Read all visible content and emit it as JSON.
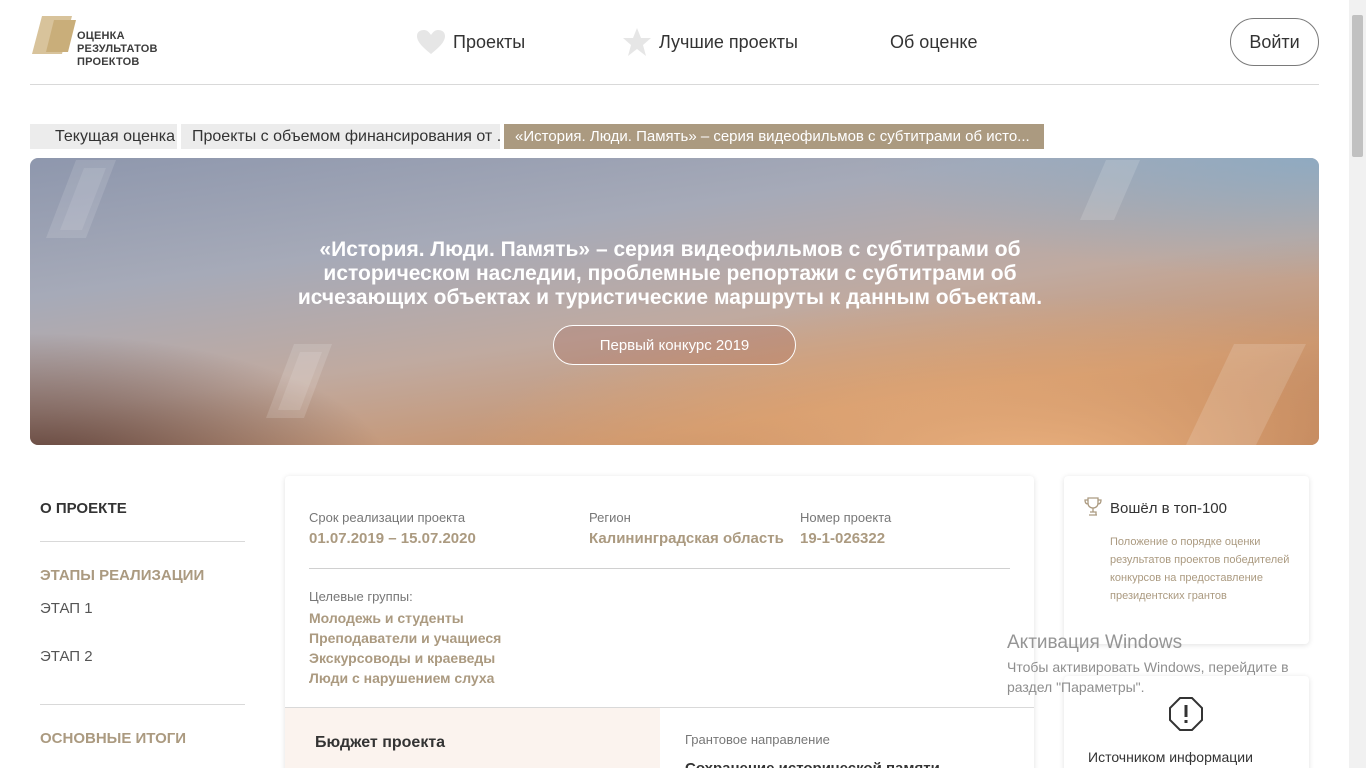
{
  "header": {
    "logo_lines": [
      "ОЦЕНКА",
      "РЕЗУЛЬТАТОВ",
      "ПРОЕКТОВ"
    ],
    "nav": {
      "projects": "Проекты",
      "best": "Лучшие проекты",
      "about": "Об оценке"
    },
    "login": "Войти"
  },
  "breadcrumbs": [
    "Текущая оценка",
    "Проекты с объемом финансирования от ...",
    "«История. Люди. Память» – серия видеофильмов с субтитрами об исто..."
  ],
  "hero": {
    "title": "«История. Люди. Память» – серия видеофильмов с субтитрами об историческом наследии, проблемные репортажи с субтитрами об исчезающих объектах и туристические маршруты к данным объектам.",
    "contest": "Первый конкурс 2019"
  },
  "sidebar": {
    "about": "О ПРОЕКТЕ",
    "stages": "ЭТАПЫ РЕАЛИЗАЦИИ",
    "stage1": "ЭТАП 1",
    "stage2": "ЭТАП 2",
    "results": "ОСНОВНЫЕ ИТОГИ"
  },
  "project": {
    "term_label": "Срок реализации проекта",
    "term": "01.07.2019 – 15.07.2020",
    "region_label": "Регион",
    "region": "Калининградская область",
    "number_label": "Номер проекта",
    "number": "19-1-026322",
    "groups_label": "Целевые группы:",
    "groups": [
      "Молодежь и студенты",
      "Преподаватели и учащиеся",
      "Экскурсоводы и краеведы",
      "Люди с нарушением слуха"
    ],
    "budget_title": "Бюджет проекта",
    "grant_label": "Грантовое направление",
    "grant_value": "Сохранение исторической памяти"
  },
  "top100": {
    "title": "Вошёл в топ-100",
    "text": "Положение о порядке оценки результатов проектов победителей конкурсов на предоставление президентских грантов"
  },
  "source": {
    "text": "Источником информации"
  },
  "watermark": {
    "title": "Активация Windows",
    "text": "Чтобы активировать Windows, перейдите в раздел \"Параметры\"."
  },
  "colors": {
    "accent": "#ab9a80",
    "breadcrumb_active": "#ab9a80",
    "budget_bg": "#fbf3ee"
  }
}
